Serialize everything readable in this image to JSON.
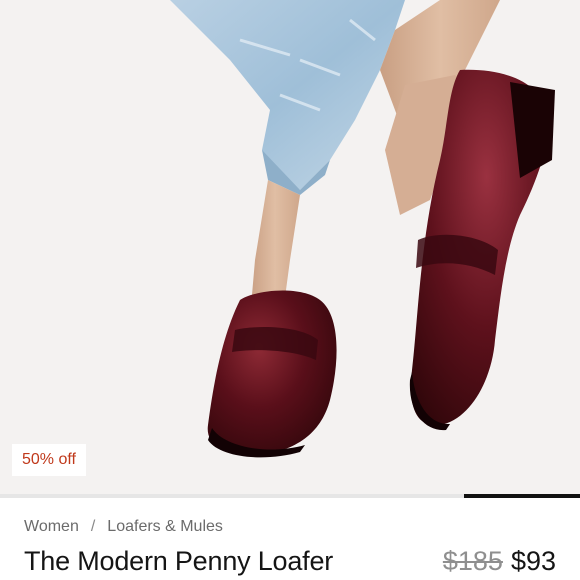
{
  "product": {
    "badge": "50% off",
    "title": "The Modern Penny Loafer",
    "original_price": "$185",
    "sale_price": "$93",
    "image_alt": "Burgundy penny loafers worn with light-wash cropped jeans"
  },
  "breadcrumb": {
    "items": [
      "Women",
      "Loafers & Mules"
    ],
    "separator": "/"
  },
  "gallery": {
    "active_index_fraction": 1.0
  },
  "colors": {
    "badge_text": "#c0391b",
    "leather": "#5a0f1a",
    "denim": "#a9c6dd",
    "skin": "#d9b59a",
    "background": "#f4f2f1"
  }
}
